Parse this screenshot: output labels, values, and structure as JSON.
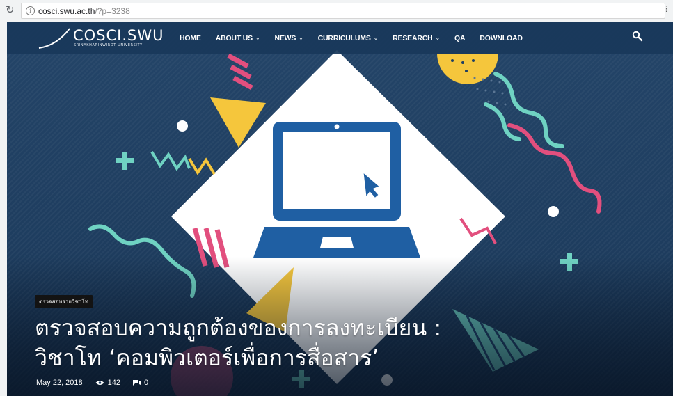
{
  "browser": {
    "reload_icon": "reload-icon",
    "info_icon": "info-icon",
    "info_glyph": "i",
    "url_host": "cosci.swu.ac.th",
    "url_path": "/?p=3238",
    "menu_icon": "kebab-menu-icon"
  },
  "site": {
    "logo_text": "COSCI.SWU",
    "logo_subtext": "SRINAKHARINWIROT UNIVERSITY"
  },
  "nav": {
    "items": [
      {
        "label": "HOME",
        "dropdown": false
      },
      {
        "label": "ABOUT US",
        "dropdown": true
      },
      {
        "label": "NEWS",
        "dropdown": true
      },
      {
        "label": "CURRICULUMS",
        "dropdown": true
      },
      {
        "label": "RESEARCH",
        "dropdown": true
      },
      {
        "label": "QA",
        "dropdown": false
      },
      {
        "label": "DOWNLOAD",
        "dropdown": false
      }
    ],
    "chevron_glyph": "⌄",
    "search_icon": "search-icon"
  },
  "post": {
    "category": "ตรวจสอบรายวิชาโท",
    "title_line1": "ตรวจสอบความถูกต้องของการลงทะเบียน :",
    "title_line2": "วิชาโท ‘คอมพิวเตอร์เพื่อการสื่อสาร’",
    "date": "May 22, 2018",
    "views": "142",
    "comments": "0",
    "views_icon": "eye-icon",
    "comments_icon": "comment-icon"
  },
  "colors": {
    "nav_bg": "#19385a",
    "hero_bg": "#1e3f63",
    "laptop_blue": "#1f5fa3",
    "accent_yellow": "#f5c63c",
    "accent_pink": "#e24f7e",
    "accent_teal": "#6fd2c2"
  }
}
